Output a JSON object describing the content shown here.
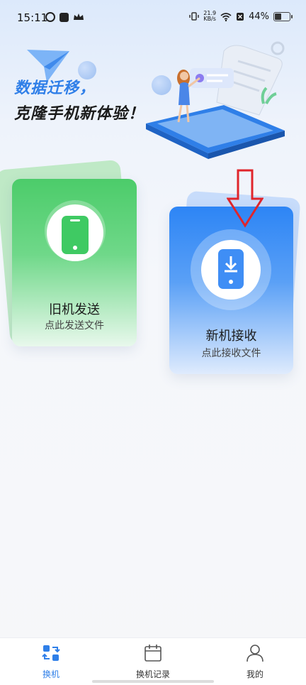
{
  "status_bar": {
    "time": "15:11",
    "net_speed_value": "21.9",
    "net_speed_unit": "KB/s",
    "battery": "44%"
  },
  "hero": {
    "title_line1": "数据迁移，",
    "title_line2": "克隆手机新体验！"
  },
  "cards": {
    "old_phone": {
      "title": "旧机发送",
      "subtitle": "点此发送文件",
      "accent": "#4ccc6a"
    },
    "new_phone": {
      "title": "新机接收",
      "subtitle": "点此接收文件",
      "accent": "#2d85f5"
    }
  },
  "annotation": {
    "color": "#e0252b",
    "icon": "down-arrow-icon"
  },
  "bottom_nav": {
    "items": [
      {
        "label": "换机",
        "icon": "swap-icon",
        "active": true
      },
      {
        "label": "换机记录",
        "icon": "calendar-icon",
        "active": false
      },
      {
        "label": "我的",
        "icon": "user-icon",
        "active": false
      }
    ]
  }
}
